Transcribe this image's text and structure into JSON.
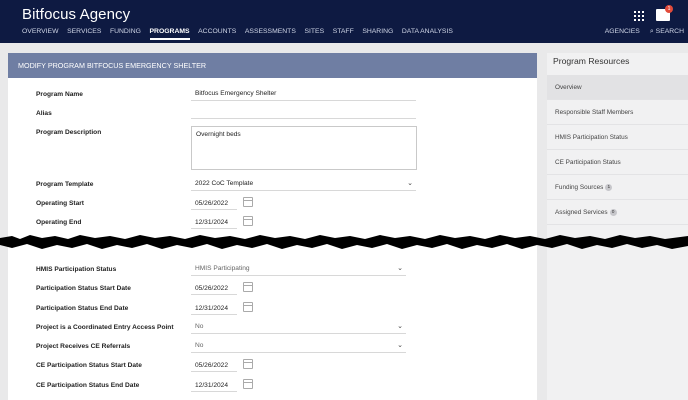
{
  "header": {
    "brand": "Bitfocus Agency",
    "nav": [
      "OVERVIEW",
      "SERVICES",
      "FUNDING",
      "PROGRAMS",
      "ACCOUNTS",
      "ASSESSMENTS",
      "SITES",
      "STAFF",
      "SHARING",
      "DATA ANALYSIS"
    ],
    "active_nav": "PROGRAMS",
    "agencies": "AGENCIES",
    "search": "SEARCH",
    "mail_badge": "1"
  },
  "panel": {
    "title": "MODIFY PROGRAM BITFOCUS EMERGENCY SHELTER",
    "fields": {
      "program_name": {
        "label": "Program Name",
        "value": "Bitfocus Emergency Shelter"
      },
      "alias": {
        "label": "Alias",
        "value": ""
      },
      "program_description": {
        "label": "Program Description",
        "value": "Overnight beds"
      },
      "program_template": {
        "label": "Program Template",
        "value": "2022 CoC Template"
      },
      "operating_start": {
        "label": "Operating Start",
        "value": "05/26/2022"
      },
      "operating_end": {
        "label": "Operating End",
        "value": "12/31/2024"
      },
      "hmis_status": {
        "label": "HMIS Participation Status",
        "value": "HMIS Participating"
      },
      "participation_start": {
        "label": "Participation Status Start Date",
        "value": "05/26/2022"
      },
      "participation_end": {
        "label": "Participation Status End Date",
        "value": "12/31/2024"
      },
      "ce_access_point": {
        "label": "Project is a Coordinated Entry Access Point",
        "value": "No"
      },
      "ce_referrals": {
        "label": "Project Receives CE Referrals",
        "value": "No"
      },
      "ce_start": {
        "label": "CE Participation Status Start Date",
        "value": "05/26/2022"
      },
      "ce_end": {
        "label": "CE Participation Status End Date",
        "value": "12/31/2024"
      }
    }
  },
  "sidebar": {
    "title": "Program Resources",
    "items": [
      {
        "label": "Overview",
        "count": ""
      },
      {
        "label": "Responsible Staff Members",
        "count": ""
      },
      {
        "label": "HMIS Participation Status",
        "count": ""
      },
      {
        "label": "CE Participation Status",
        "count": ""
      },
      {
        "label": "Funding Sources",
        "count": "1"
      },
      {
        "label": "Assigned Services",
        "count": "0"
      }
    ]
  }
}
